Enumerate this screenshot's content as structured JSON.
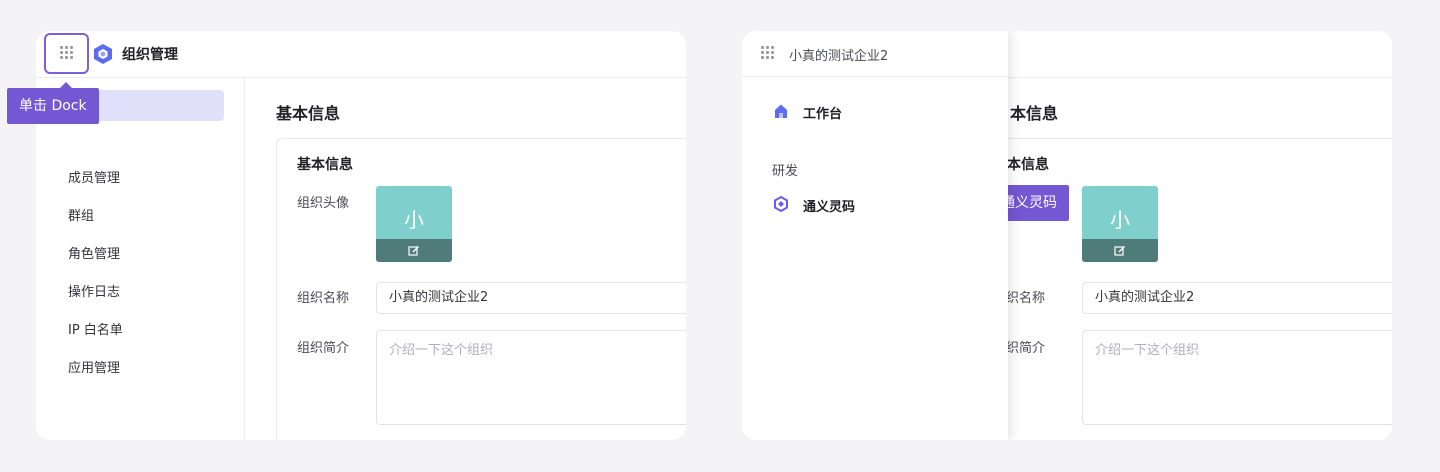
{
  "left_panel": {
    "header": {
      "title": "组织管理"
    },
    "sidebar": {
      "items": [
        {
          "label": "成员管理"
        },
        {
          "label": "群组"
        },
        {
          "label": "角色管理"
        },
        {
          "label": "操作日志"
        },
        {
          "label": "IP 白名单"
        },
        {
          "label": "应用管理"
        }
      ]
    },
    "main": {
      "page_title": "基本信息",
      "card": {
        "title": "基本信息",
        "avatar_label": "组织头像",
        "avatar_char": "小",
        "name_label": "组织名称",
        "name_value": "小真的测试企业2",
        "intro_label": "组织简介",
        "intro_placeholder": "介绍一下这个组织"
      }
    },
    "tooltip": "单击 Dock"
  },
  "right_panel": {
    "drawer": {
      "org_name": "小真的测试企业2",
      "items": [
        {
          "label": "工作台"
        }
      ],
      "section": "研发",
      "section_items": [
        {
          "label": "通义灵码"
        }
      ]
    },
    "behind": {
      "page_title_partial": "本信息",
      "card_title_partial": "基本信息",
      "avatar_char": "小",
      "name_label_partial": "组织名称",
      "name_value": "小真的测试企业2",
      "intro_label_partial": "组织简介",
      "intro_placeholder": "介绍一下这个组织"
    },
    "tooltip": "单击通义灵码"
  },
  "colors": {
    "accent": "#7457d3",
    "highlight_border": "#7a62d6",
    "sidebar_active": "#e0e0fb",
    "avatar_bg": "#7fcfcd",
    "avatar_edit_bar": "#4f7c7b"
  },
  "icons": {
    "dock": "grid-dots-icon",
    "app": "hexagon-logo-icon",
    "workbench": "house-icon",
    "lingma": "tongyi-lingma-icon",
    "edit": "edit-icon"
  }
}
